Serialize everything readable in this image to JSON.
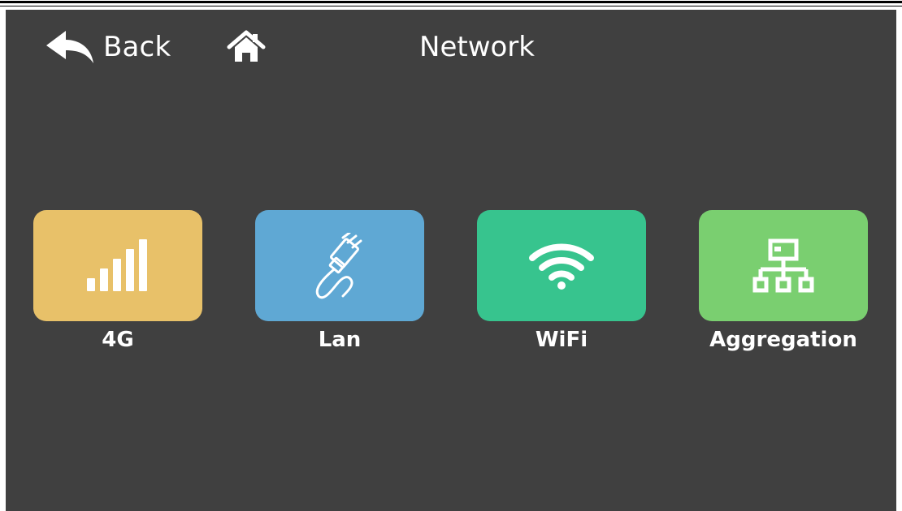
{
  "header": {
    "back_label": "Back",
    "title": "Network",
    "back_icon": "reply-arrow-icon",
    "home_icon": "home-icon"
  },
  "tiles": [
    {
      "label": "4G",
      "icon": "signal-bars-icon",
      "color": "#E8C169"
    },
    {
      "label": "Lan",
      "icon": "ethernet-cable-icon",
      "color": "#5FA8D4"
    },
    {
      "label": "WiFi",
      "icon": "wifi-icon",
      "color": "#37C48E"
    },
    {
      "label": "Aggregation",
      "icon": "network-topology-icon",
      "color": "#7ACF70"
    }
  ],
  "colors": {
    "background": "#404040",
    "text": "#FFFFFF"
  }
}
